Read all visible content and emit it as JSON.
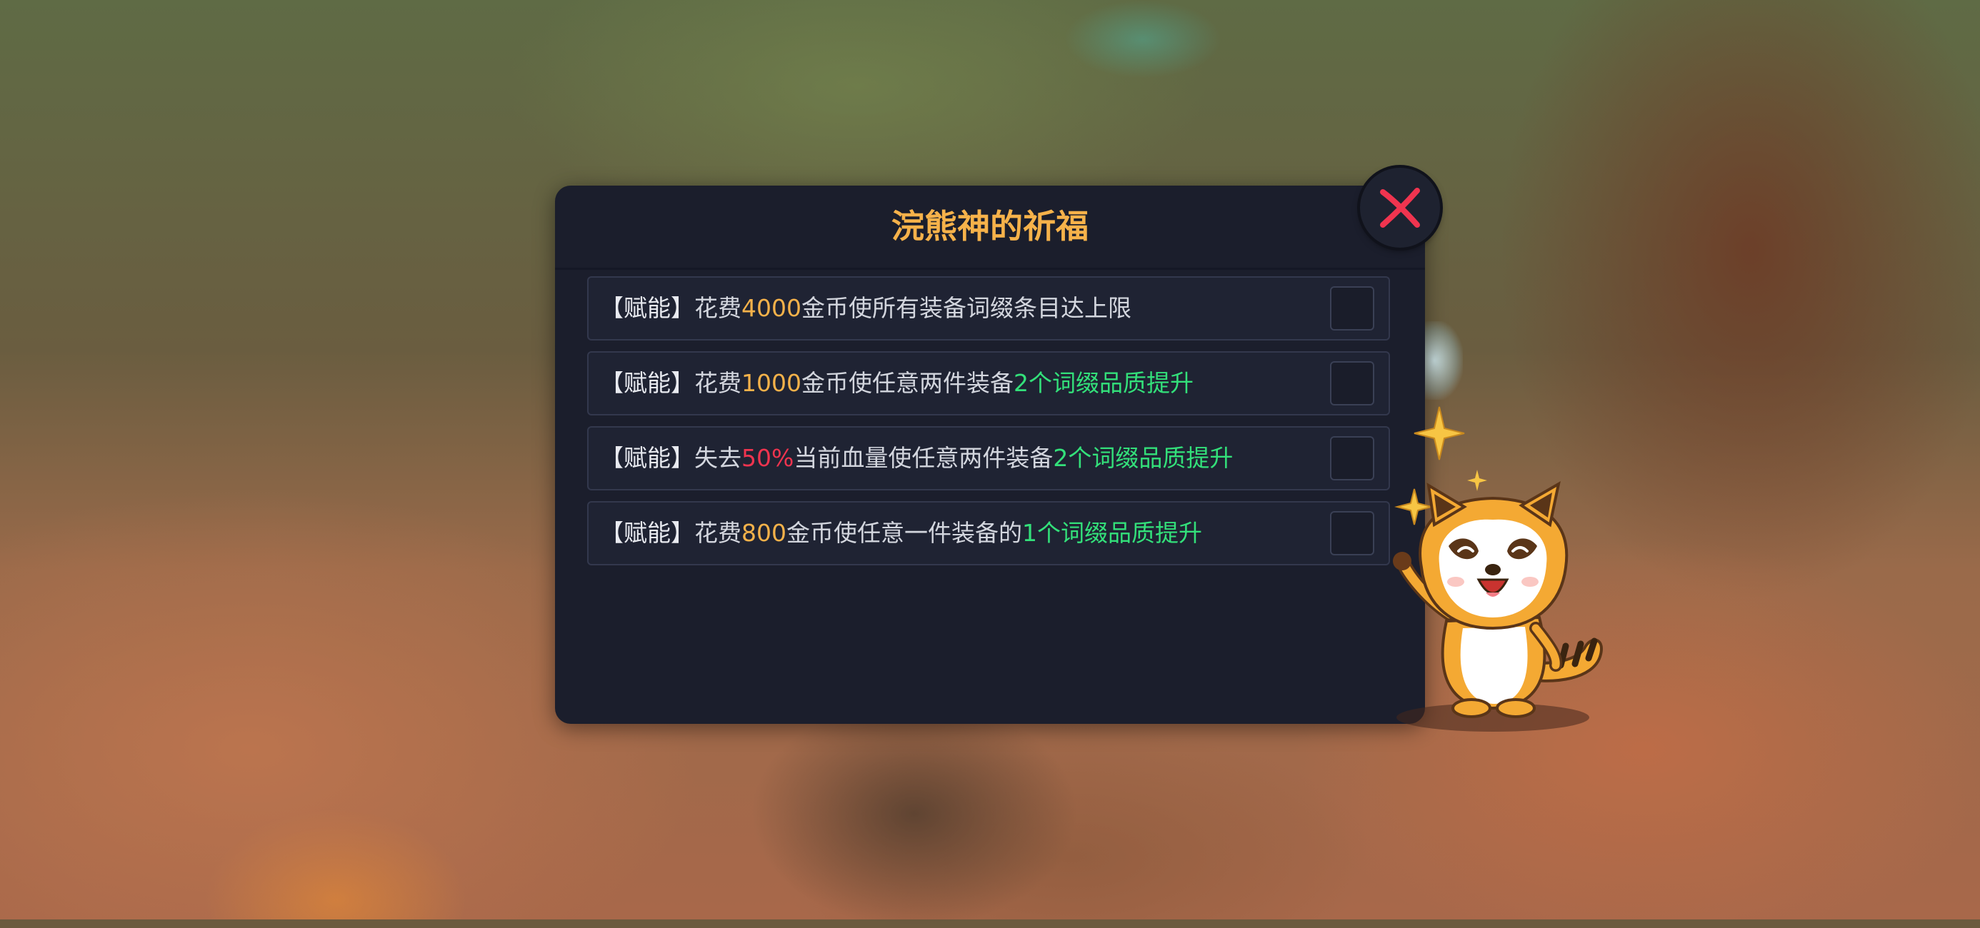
{
  "dialog": {
    "title": "浣熊神的祈福",
    "close_icon": "close-x-icon",
    "colors": {
      "title": "#f6b24a",
      "panel": "#1b1e2c",
      "gold_value": "#f6b24a",
      "red_value": "#f0344f",
      "green_value": "#33e07a",
      "close_x": "#f0344f"
    },
    "options": [
      {
        "tag": "【赋能】",
        "pre": "花费",
        "value": "4000",
        "value_color": "gold",
        "mid": "金币使所有装备词缀条目达上限",
        "highlight": "",
        "post": "",
        "checked": false
      },
      {
        "tag": "【赋能】",
        "pre": "花费",
        "value": "1000",
        "value_color": "gold",
        "mid": "金币使任意两件装备",
        "highlight": "2个词缀品质提升",
        "post": "",
        "checked": false
      },
      {
        "tag": "【赋能】",
        "pre": "失去",
        "value": "50%",
        "value_color": "red",
        "mid": "当前血量使任意两件装备",
        "highlight": "2个词缀品质提升",
        "post": "",
        "checked": false
      },
      {
        "tag": "【赋能】",
        "pre": "花费",
        "value": "800",
        "value_color": "gold",
        "mid": "金币使任意一件装备的",
        "highlight": "1个词缀品质提升",
        "post": "",
        "checked": false
      }
    ]
  },
  "mascot": {
    "icon": "raccoon-mascot-icon"
  }
}
